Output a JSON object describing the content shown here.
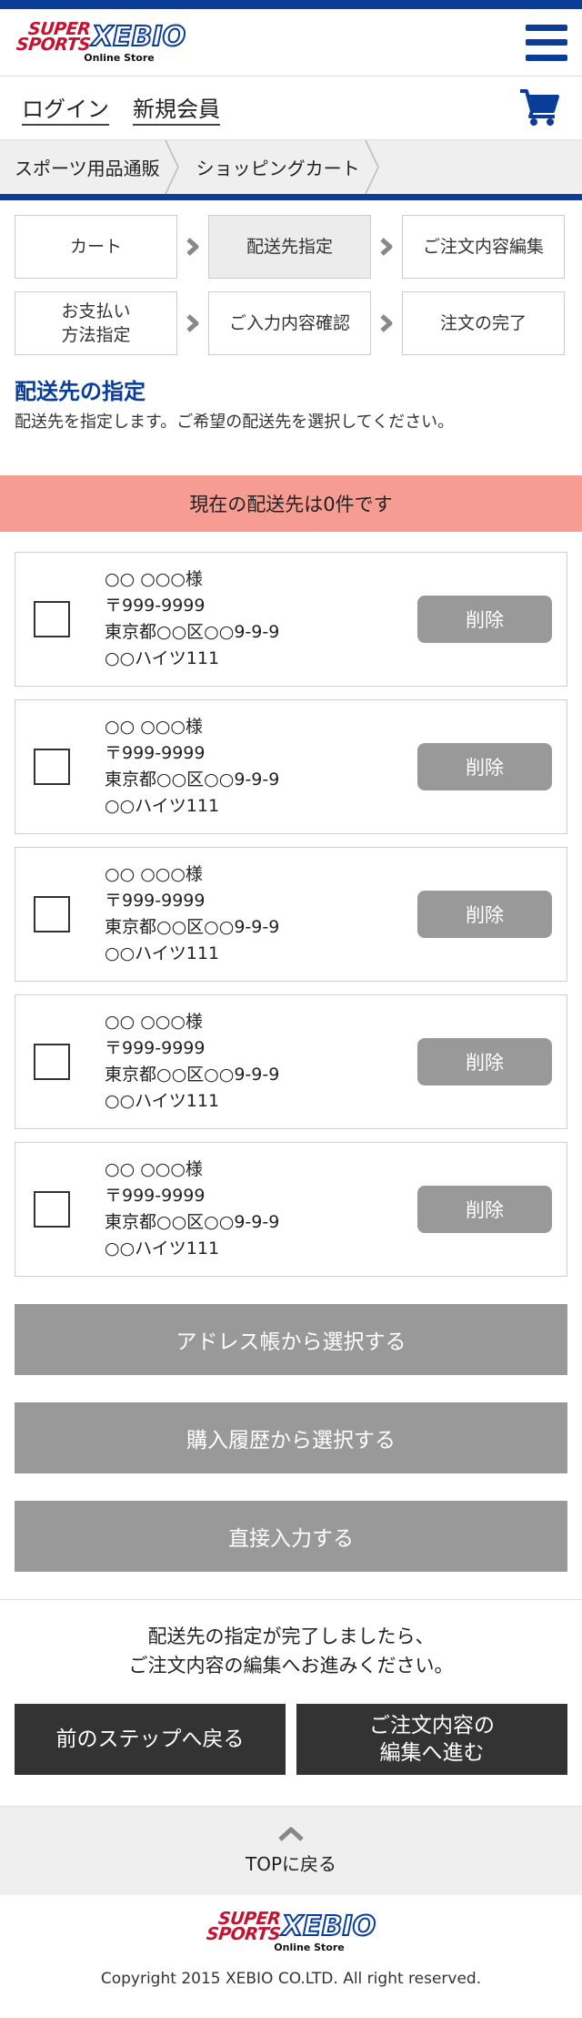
{
  "header": {
    "logo_super_top": "SUPER",
    "logo_super_bottom": "SPORTS",
    "logo_brand": "XEBIO",
    "logo_sub": "Online Store"
  },
  "account": {
    "login": "ログイン",
    "register": "新規会員"
  },
  "breadcrumb": [
    "スポーツ用品通販",
    "ショッピングカート"
  ],
  "steps": [
    {
      "label": "カート"
    },
    {
      "label": "配送先指定"
    },
    {
      "label": "ご注文内容編集"
    },
    {
      "label_line1": "お支払い",
      "label_line2": "方法指定"
    },
    {
      "label": "ご入力内容確認"
    },
    {
      "label": "注文の完了"
    }
  ],
  "section": {
    "title": "配送先の指定",
    "description": "配送先を指定します。ご希望の配送先を選択してください。"
  },
  "count_banner": "現在の配送先は0件です",
  "addresses": [
    {
      "name": "○○ ○○○様",
      "zip": "〒999-9999",
      "line1": "東京都○○区○○9-9-9",
      "line2": "○○ハイツ111",
      "delete": "削除"
    },
    {
      "name": "○○ ○○○様",
      "zip": "〒999-9999",
      "line1": "東京都○○区○○9-9-9",
      "line2": "○○ハイツ111",
      "delete": "削除"
    },
    {
      "name": "○○ ○○○様",
      "zip": "〒999-9999",
      "line1": "東京都○○区○○9-9-9",
      "line2": "○○ハイツ111",
      "delete": "削除"
    },
    {
      "name": "○○ ○○○様",
      "zip": "〒999-9999",
      "line1": "東京都○○区○○9-9-9",
      "line2": "○○ハイツ111",
      "delete": "削除"
    },
    {
      "name": "○○ ○○○様",
      "zip": "〒999-9999",
      "line1": "東京都○○区○○9-9-9",
      "line2": "○○ハイツ111",
      "delete": "削除"
    }
  ],
  "select_buttons": {
    "address_book": "アドレス帳から選択する",
    "history": "購入履歴から選択する",
    "direct": "直接入力する"
  },
  "next_info": {
    "line1": "配送先の指定が完了しましたら、",
    "line2": "ご注文内容の編集へお進みください。"
  },
  "nav": {
    "back": "前のステップへ戻る",
    "next_line1": "ご注文内容の",
    "next_line2": "編集へ進む"
  },
  "to_top": "TOPに戻る",
  "copyright": "Copyright 2015 XEBIO CO.LTD. All right reserved.",
  "colors": {
    "brand_blue": "#0a3c9a",
    "brand_red": "#c4122f",
    "banner_pink": "#f79c93",
    "button_gray": "#999999",
    "button_dark": "#333333"
  }
}
